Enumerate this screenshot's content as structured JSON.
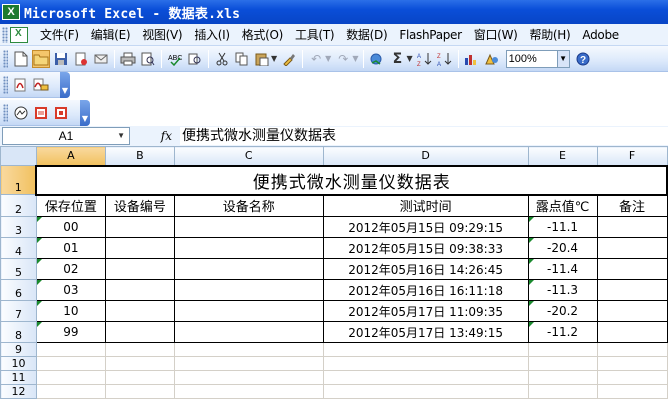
{
  "window": {
    "title": "Microsoft Excel - 数据表.xls",
    "app_icon_letter": "X"
  },
  "menu": {
    "items": [
      {
        "label": "文件(F)",
        "name": "menu-file"
      },
      {
        "label": "编辑(E)",
        "name": "menu-edit"
      },
      {
        "label": "视图(V)",
        "name": "menu-view"
      },
      {
        "label": "插入(I)",
        "name": "menu-insert"
      },
      {
        "label": "格式(O)",
        "name": "menu-format"
      },
      {
        "label": "工具(T)",
        "name": "menu-tools"
      },
      {
        "label": "数据(D)",
        "name": "menu-data"
      },
      {
        "label": "FlashPaper",
        "name": "menu-flashpaper"
      },
      {
        "label": "窗口(W)",
        "name": "menu-window"
      },
      {
        "label": "帮助(H)",
        "name": "menu-help"
      },
      {
        "label": "Adobe",
        "name": "menu-adobe"
      }
    ]
  },
  "toolbar": {
    "zoom_value": "100%"
  },
  "formula_bar": {
    "name_box": "A1",
    "fx_label": "fx",
    "content": "便携式微水测量仪数据表"
  },
  "sheet": {
    "columns": [
      "A",
      "B",
      "C",
      "D",
      "E",
      "F"
    ],
    "title": "便携式微水测量仪数据表",
    "headers": [
      "保存位置",
      "设备编号",
      "设备名称",
      "测试时间",
      "露点值℃",
      "备注"
    ],
    "rows": [
      {
        "pos": "00",
        "id": "",
        "name": "",
        "time": "2012年05月15日 09:29:15",
        "dew": "-11.1",
        "note": ""
      },
      {
        "pos": "01",
        "id": "",
        "name": "",
        "time": "2012年05月15日 09:38:33",
        "dew": "-20.4",
        "note": ""
      },
      {
        "pos": "02",
        "id": "",
        "name": "",
        "time": "2012年05月16日 14:26:45",
        "dew": "-11.4",
        "note": ""
      },
      {
        "pos": "03",
        "id": "",
        "name": "",
        "time": "2012年05月16日 16:11:18",
        "dew": "-11.3",
        "note": ""
      },
      {
        "pos": "10",
        "id": "",
        "name": "",
        "time": "2012年05月17日 11:09:35",
        "dew": "-20.2",
        "note": ""
      },
      {
        "pos": "99",
        "id": "",
        "name": "",
        "time": "2012年05月17日 13:49:15",
        "dew": "-11.2",
        "note": ""
      }
    ],
    "row_numbers": [
      "1",
      "2",
      "3",
      "4",
      "5",
      "6",
      "7",
      "8",
      "9",
      "10",
      "11",
      "12"
    ]
  }
}
